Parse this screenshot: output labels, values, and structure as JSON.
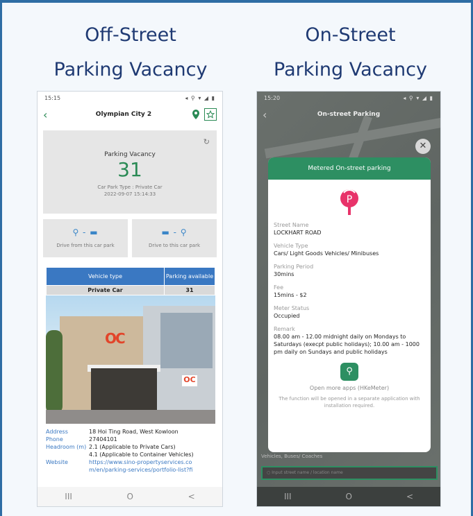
{
  "headings": {
    "left": [
      "Off-Street",
      "Parking Vacancy"
    ],
    "right": [
      "On-Street",
      "Parking Vacancy"
    ]
  },
  "left_phone": {
    "status_time": "15:15",
    "title": "Olympian City 2",
    "back_icon": "chevron-left-icon",
    "vacancy": {
      "label": "Parking Vacancy",
      "count": "31",
      "type_line": "Car Park Type : Private Car",
      "timestamp": "2022-09-07 15:14:33"
    },
    "drive_from": "Drive from this car park",
    "drive_to": "Drive to this car park",
    "table": {
      "headers": [
        "Vehicle type",
        "Parking available"
      ],
      "rows": [
        [
          "Private Car",
          "31"
        ]
      ]
    },
    "info": [
      {
        "k": "Address",
        "v": "18 Hoi Ting Road, West Kowloon"
      },
      {
        "k": "Phone",
        "v": "27404101"
      },
      {
        "k": "Headroom (m)",
        "v": "2.1 (Applicable to Private Cars)\n4.1 (Applicable to Container Vehicles)"
      },
      {
        "k": "Website",
        "v": "https://www.sino-propertyservices.co m/en/parking-services/portfolio-list?fi"
      }
    ],
    "photo_logo": "OC"
  },
  "right_phone": {
    "status_time": "15:20",
    "title": "On-street Parking",
    "close_icon": "close-icon",
    "modal_title": "Metered On-street parking",
    "fields": [
      {
        "label": "Street Name",
        "value": "LOCKHART ROAD"
      },
      {
        "label": "Vehicle Type",
        "value": "Cars/ Light Goods Vehicles/ Minibuses"
      },
      {
        "label": "Parking Period",
        "value": "30mins"
      },
      {
        "label": "Fee",
        "value": "15mins - $2"
      },
      {
        "label": "Meter Status",
        "value": "Occupied"
      },
      {
        "label": "Remark",
        "value": "08.00 am - 12.00 midnight daily on Mondays to Saturdays (execpt public holidays); 10.00 am - 1000 pm daily on Sundays and public holidays"
      }
    ],
    "apps_label": "Open more apps (HKeMeter)",
    "apps_note": "The function will be opened in a separate application with installation required.",
    "behind_text": "Vehicles, Buses/ Coaches",
    "search_placeholder": "Input street name / location name"
  },
  "navbar": [
    "III",
    "O",
    "<"
  ],
  "colors": {
    "accent_green": "#2d8f62",
    "accent_blue": "#3a78c2",
    "heading": "#1f3a73"
  }
}
